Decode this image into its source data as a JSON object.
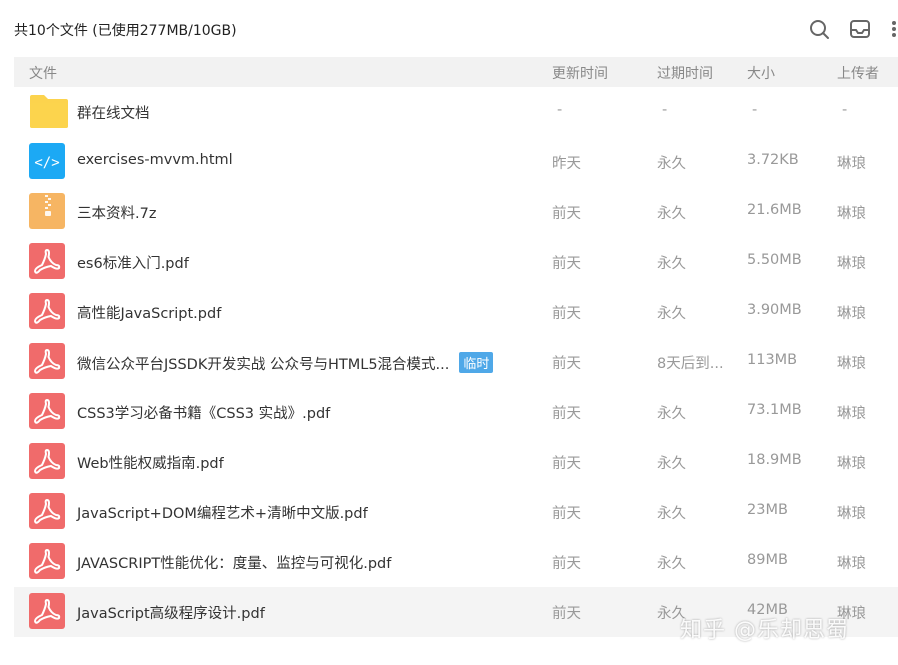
{
  "summary": "共10个文件 (已使用277MB/10GB)",
  "toolbar": {
    "icons": [
      "search-icon",
      "inbox-icon",
      "more-icon"
    ]
  },
  "columns": {
    "name": "文件",
    "updated": "更新时间",
    "expires": "过期时间",
    "size": "大小",
    "uploader": "上传者"
  },
  "files": [
    {
      "type": "folder",
      "name": "群在线文档",
      "updated": "-",
      "expires": "-",
      "size": "-",
      "uploader": "-"
    },
    {
      "type": "html",
      "name": "exercises-mvvm.html",
      "updated": "昨天",
      "expires": "永久",
      "size": "3.72KB",
      "uploader": "琳琅"
    },
    {
      "type": "zip",
      "name": "三本资料.7z",
      "updated": "前天",
      "expires": "永久",
      "size": "21.6MB",
      "uploader": "琳琅"
    },
    {
      "type": "pdf",
      "name": "es6标准入门.pdf",
      "updated": "前天",
      "expires": "永久",
      "size": "5.50MB",
      "uploader": "琳琅"
    },
    {
      "type": "pdf",
      "name": "高性能JavaScript.pdf",
      "updated": "前天",
      "expires": "永久",
      "size": "3.90MB",
      "uploader": "琳琅"
    },
    {
      "type": "pdf",
      "name": "微信公众平台JSSDK开发实战  公众号与HTML5混合模式...",
      "tag": "临时",
      "updated": "前天",
      "expires": "8天后到...",
      "size": "113MB",
      "uploader": "琳琅"
    },
    {
      "type": "pdf",
      "name": "CSS3学习必备书籍《CSS3 实战》.pdf",
      "updated": "前天",
      "expires": "永久",
      "size": "73.1MB",
      "uploader": "琳琅"
    },
    {
      "type": "pdf",
      "name": "Web性能权威指南.pdf",
      "updated": "前天",
      "expires": "永久",
      "size": "18.9MB",
      "uploader": "琳琅"
    },
    {
      "type": "pdf",
      "name": "JavaScript+DOM编程艺术+清晰中文版.pdf",
      "updated": "前天",
      "expires": "永久",
      "size": "23MB",
      "uploader": "琳琅"
    },
    {
      "type": "pdf",
      "name": "JAVASCRIPT性能优化：度量、监控与可视化.pdf",
      "updated": "前天",
      "expires": "永久",
      "size": "89MB",
      "uploader": "琳琅"
    },
    {
      "type": "pdf",
      "name": "JavaScript高级程序设计.pdf",
      "updated": "前天",
      "expires": "永久",
      "size": "42MB",
      "uploader": "琳琅"
    }
  ],
  "watermark": "知乎 @乐却思蜀",
  "colors": {
    "folder": "#fcd34d",
    "html": "#1ca9f4",
    "zip": "#f6b563",
    "pdf": "#f06b6b",
    "tag": "#4fa8e8"
  }
}
